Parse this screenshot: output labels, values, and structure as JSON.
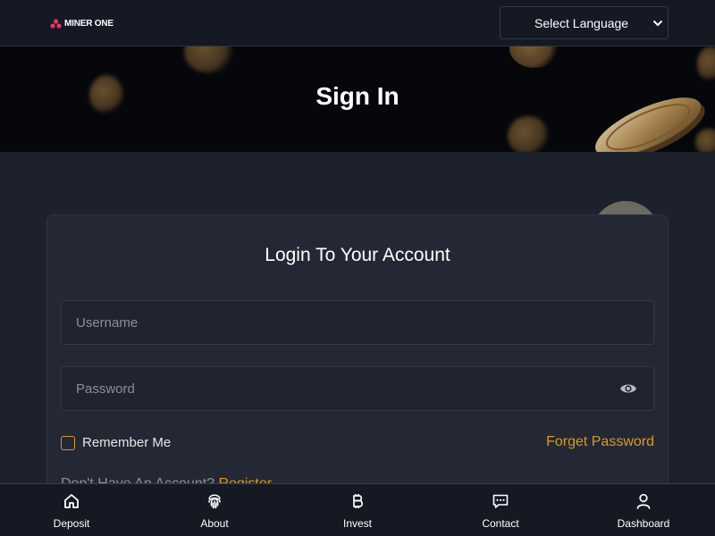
{
  "header": {
    "logo_text": "MINER ONE",
    "language_select": {
      "selected": "Select Language"
    }
  },
  "banner": {
    "title": "Sign In"
  },
  "login": {
    "title": "Login To Your Account",
    "username_placeholder": "Username",
    "password_placeholder": "Password",
    "remember_label": "Remember Me",
    "forget_label": "Forget Password",
    "no_account_text": "Don't Have An Account?",
    "register_label": "Register"
  },
  "bottom_nav": {
    "items": [
      {
        "label": "Deposit",
        "icon": "home-icon"
      },
      {
        "label": "About",
        "icon": "fingerprint-icon"
      },
      {
        "label": "Invest",
        "icon": "bitcoin-icon"
      },
      {
        "label": "Contact",
        "icon": "chat-icon"
      },
      {
        "label": "Dashboard",
        "icon": "user-icon"
      }
    ]
  },
  "colors": {
    "accent": "#d99a1e",
    "background": "#1c212c",
    "card": "#232834",
    "header": "#141924"
  }
}
